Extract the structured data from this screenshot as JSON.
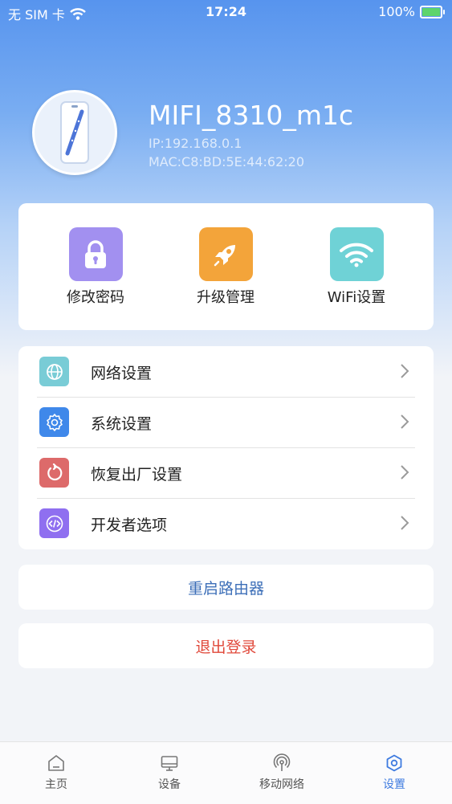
{
  "status_bar": {
    "carrier": "无 SIM 卡",
    "time": "17:24",
    "battery": "100%"
  },
  "device": {
    "name": "MIFI_8310_m1c",
    "ip": "IP:192.168.0.1",
    "mac": "MAC:C8:BD:5E:44:62:20"
  },
  "quick_actions": [
    {
      "label": "修改密码",
      "icon": "lock-icon",
      "color": "#a290f0"
    },
    {
      "label": "升级管理",
      "icon": "rocket-icon",
      "color": "#f3a43a"
    },
    {
      "label": "WiFi设置",
      "icon": "wifi-icon",
      "color": "#6fd2d6"
    }
  ],
  "menu": [
    {
      "label": "网络设置",
      "icon": "globe-icon",
      "color": "#79ccd6"
    },
    {
      "label": "系统设置",
      "icon": "gear-icon",
      "color": "#3f88ea"
    },
    {
      "label": "恢复出厂设置",
      "icon": "reset-icon",
      "color": "#dd6a6a"
    },
    {
      "label": "开发者选项",
      "icon": "code-icon",
      "color": "#8f6ff0"
    }
  ],
  "buttons": {
    "reboot": "重启路由器",
    "logout": "退出登录"
  },
  "tabs": [
    {
      "label": "主页",
      "icon": "home-icon"
    },
    {
      "label": "设备",
      "icon": "monitor-icon"
    },
    {
      "label": "移动网络",
      "icon": "signal-icon"
    },
    {
      "label": "设置",
      "icon": "settings-icon",
      "active": true
    }
  ],
  "colors": {
    "accent": "#3e7be0",
    "logout": "#e0483a",
    "reboot": "#3d6fb8"
  }
}
